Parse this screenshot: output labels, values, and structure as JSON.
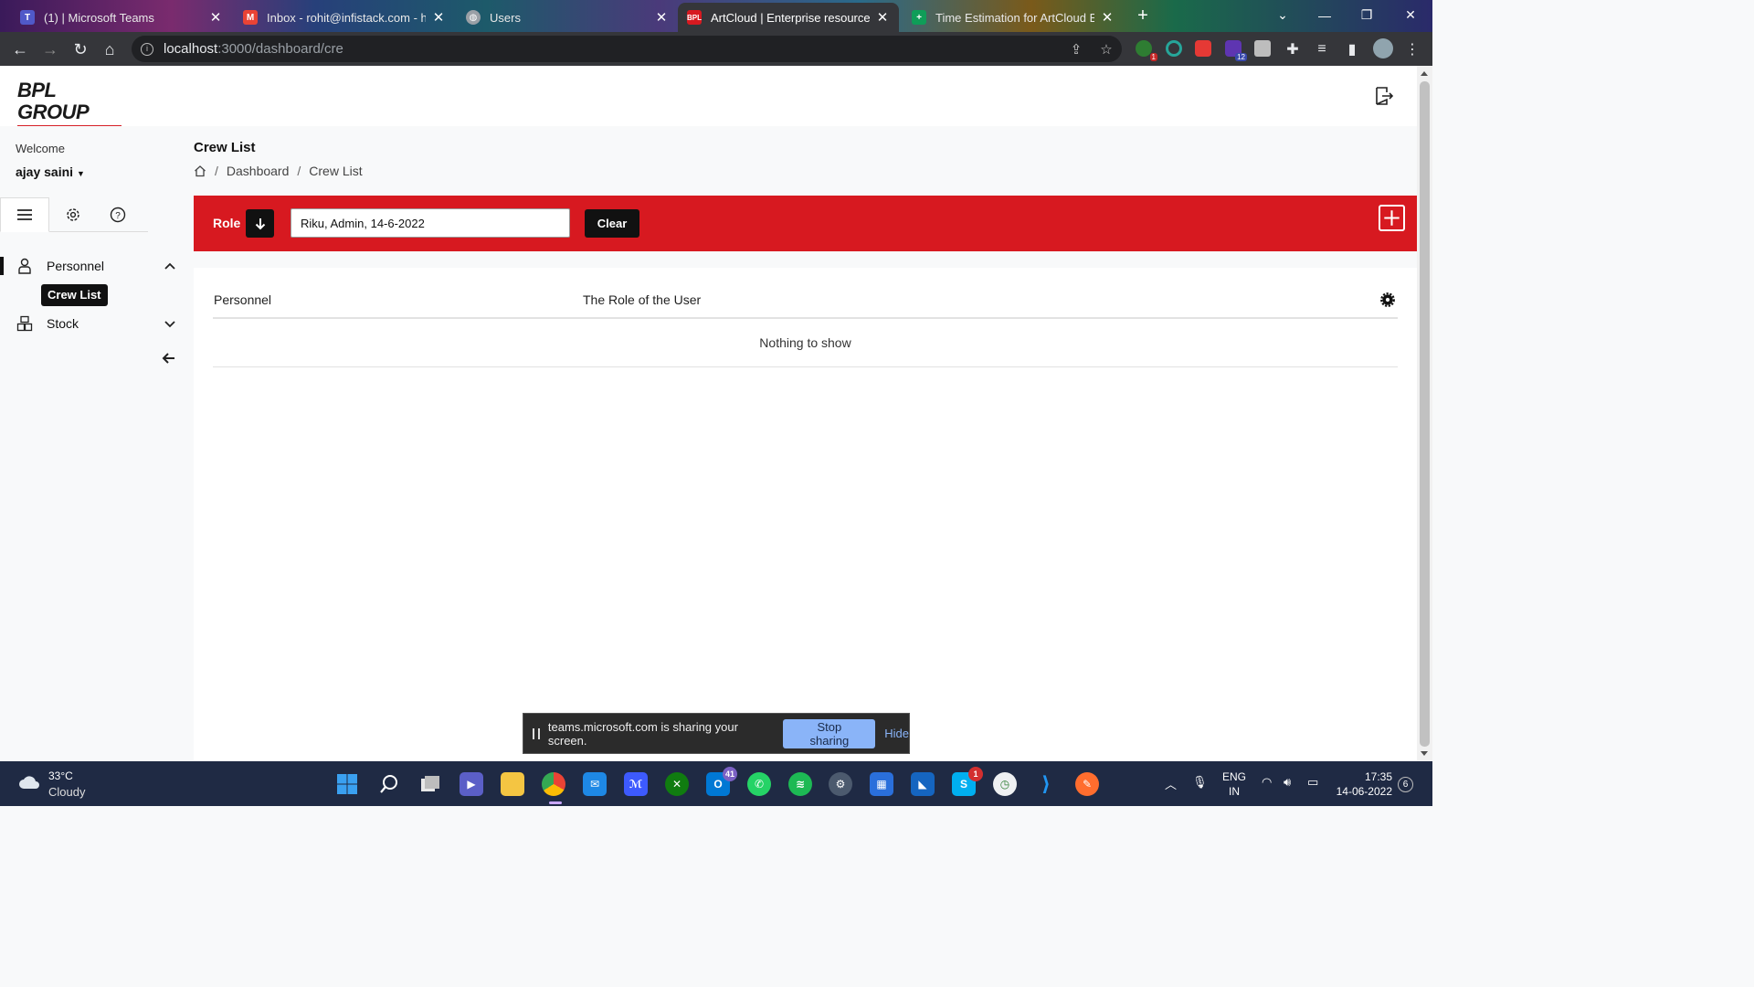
{
  "browser": {
    "tabs": [
      {
        "title": "(1) | Microsoft Teams",
        "icon": "teams-icon",
        "color": "#5059c9"
      },
      {
        "title": "Inbox - rohit@infistack.com - htt",
        "icon": "gmail-icon",
        "color": "#ea4335"
      },
      {
        "title": "Users",
        "icon": "globe-icon",
        "color": "#9aa0a6"
      },
      {
        "title": "ArtCloud | Enterprise resource pla",
        "icon": "bpl-icon",
        "color": "#d71920"
      },
      {
        "title": "Time Estimation for ArtCloud ERP",
        "icon": "sheets-icon",
        "color": "#0f9d58"
      }
    ],
    "url_host": "localhost",
    "url_path": ":3000/dashboard/cre",
    "extension_badges": {
      "ext1": "1",
      "ext4": "12"
    }
  },
  "app": {
    "logo_text": "BPL GROUP",
    "brand_color": "#d71920"
  },
  "sidebar": {
    "welcome": "Welcome",
    "username": "ajay saini",
    "tabs": [
      "menu-icon",
      "settings-icon",
      "help-icon"
    ],
    "items": [
      {
        "label": "Personnel",
        "icon": "person-icon",
        "expanded": true
      },
      {
        "label": "Stock",
        "icon": "warehouse-icon",
        "expanded": false
      }
    ],
    "active_subitem": "Crew List"
  },
  "main": {
    "title": "Crew List",
    "breadcrumb": [
      "Dashboard",
      "Crew List"
    ],
    "filter": {
      "label": "Role",
      "search_value": "Riku, Admin, 14-6-2022",
      "clear_label": "Clear"
    },
    "table": {
      "columns": [
        "Personnel",
        "The Role of the User"
      ],
      "empty_text": "Nothing to show"
    }
  },
  "share_banner": {
    "text": "teams.microsoft.com is sharing your screen.",
    "stop_label": "Stop sharing",
    "hide_label": "Hide"
  },
  "taskbar": {
    "weather_temp": "33°C",
    "weather_cond": "Cloudy",
    "badge_mail": "41",
    "badge_skype": "1",
    "lang_line1": "ENG",
    "lang_line2": "IN",
    "time": "17:35",
    "date": "14-06-2022",
    "notifications": "6"
  }
}
